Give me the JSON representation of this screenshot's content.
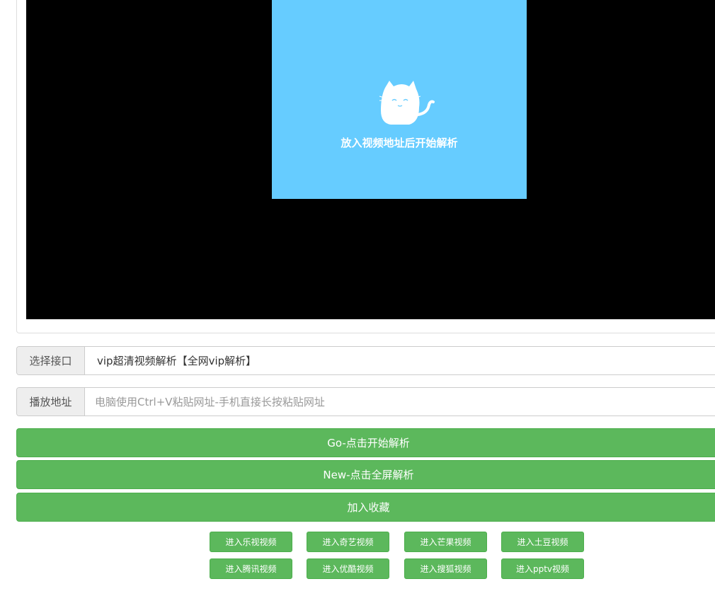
{
  "player": {
    "poster_text": "放入视频地址后开始解析"
  },
  "api_row": {
    "label": "选择接口",
    "selected": "vip超清视频解析【全网vip解析】"
  },
  "url_row": {
    "label": "播放地址",
    "placeholder": "电脑使用Ctrl+V粘贴网址-手机直接长按粘贴网址",
    "value": ""
  },
  "buttons": {
    "go": "Go-点击开始解析",
    "new_fullscreen": "New-点击全屏解析",
    "favorite": "加入收藏"
  },
  "site_links": [
    "进入乐视视频",
    "进入奇艺视频",
    "进入芒果视频",
    "进入土豆视频",
    "进入腾讯视频",
    "进入优酷视频",
    "进入搜狐视频",
    "进入pptv视频"
  ],
  "colors": {
    "poster_bg": "#66ccff",
    "button_green": "#5cb85c",
    "player_bg": "#000000"
  }
}
